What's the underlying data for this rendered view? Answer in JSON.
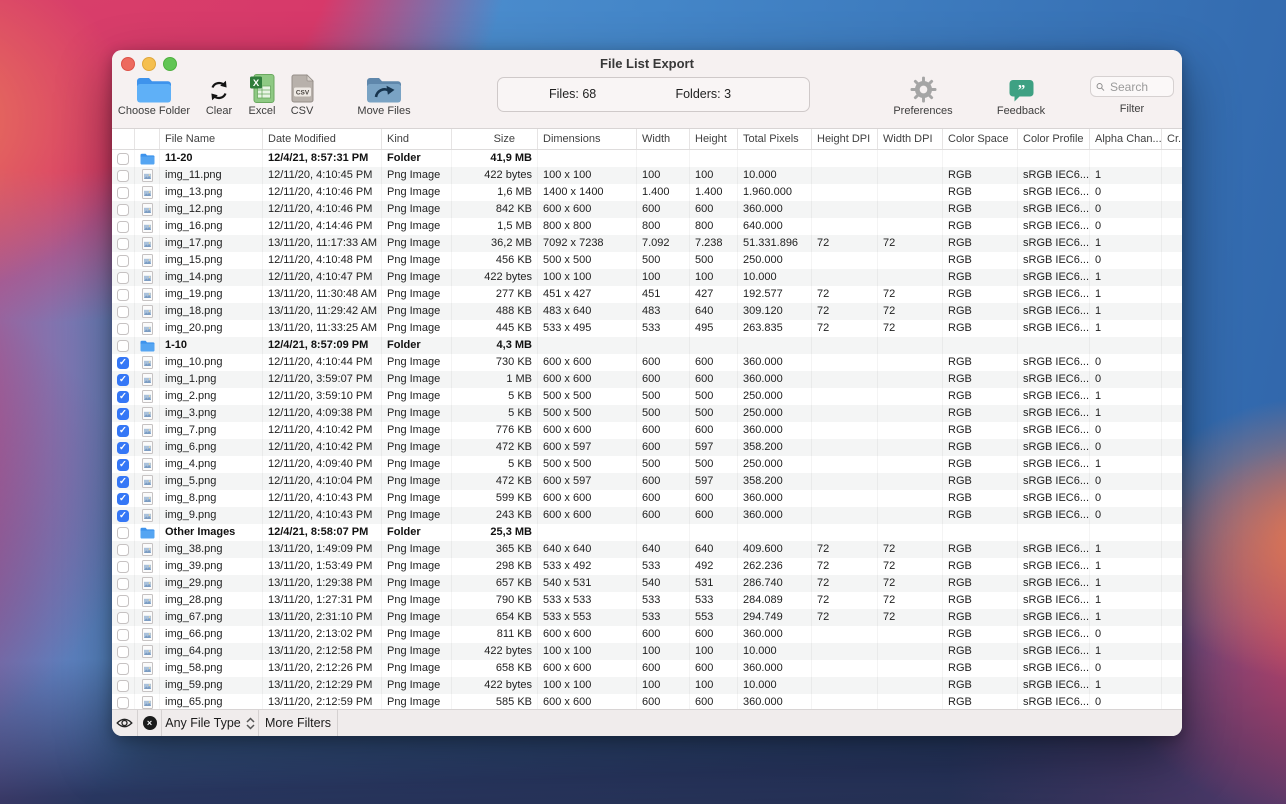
{
  "window": {
    "title": "File List Export"
  },
  "toolbar": {
    "choose_folder": "Choose Folder",
    "clear": "Clear",
    "excel": "Excel",
    "csv": "CSV",
    "move_files": "Move Files",
    "stats": {
      "files": "Files: 68",
      "folders": "Folders: 3"
    },
    "preferences": "Preferences",
    "feedback": "Feedback",
    "search_placeholder": "Search",
    "filter_label": "Filter"
  },
  "table": {
    "columns": [
      "File Name",
      "Date Modified",
      "Kind",
      "Size",
      "Dimensions",
      "Width",
      "Height",
      "Total Pixels",
      "Height DPI",
      "Width DPI",
      "Color Space",
      "Color Profile",
      "Alpha Chan...",
      "Cr..."
    ],
    "rows": [
      {
        "type": "folder",
        "checked": false,
        "name": "11-20",
        "date": "12/4/21, 8:57:31 PM",
        "kind": "Folder",
        "size": "41,9 MB",
        "dims": "",
        "w": "",
        "h": "",
        "px": "",
        "hdpi": "",
        "wdpi": "",
        "cs": "",
        "cp": "",
        "alpha": ""
      },
      {
        "type": "file",
        "checked": false,
        "name": "img_11.png",
        "date": "12/11/20, 4:10:45 PM",
        "kind": "Png Image",
        "size": "422 bytes",
        "dims": "100 x 100",
        "w": "100",
        "h": "100",
        "px": "10.000",
        "hdpi": "",
        "wdpi": "",
        "cs": "RGB",
        "cp": "sRGB IEC6...",
        "alpha": "1"
      },
      {
        "type": "file",
        "checked": false,
        "name": "img_13.png",
        "date": "12/11/20, 4:10:46 PM",
        "kind": "Png Image",
        "size": "1,6 MB",
        "dims": "1400 x 1400",
        "w": "1.400",
        "h": "1.400",
        "px": "1.960.000",
        "hdpi": "",
        "wdpi": "",
        "cs": "RGB",
        "cp": "sRGB IEC6...",
        "alpha": "0"
      },
      {
        "type": "file",
        "checked": false,
        "name": "img_12.png",
        "date": "12/11/20, 4:10:46 PM",
        "kind": "Png Image",
        "size": "842 KB",
        "dims": "600 x 600",
        "w": "600",
        "h": "600",
        "px": "360.000",
        "hdpi": "",
        "wdpi": "",
        "cs": "RGB",
        "cp": "sRGB IEC6...",
        "alpha": "0"
      },
      {
        "type": "file",
        "checked": false,
        "name": "img_16.png",
        "date": "12/11/20, 4:14:46 PM",
        "kind": "Png Image",
        "size": "1,5 MB",
        "dims": "800 x 800",
        "w": "800",
        "h": "800",
        "px": "640.000",
        "hdpi": "",
        "wdpi": "",
        "cs": "RGB",
        "cp": "sRGB IEC6...",
        "alpha": "0"
      },
      {
        "type": "file",
        "checked": false,
        "name": "img_17.png",
        "date": "13/11/20, 11:17:33 AM",
        "kind": "Png Image",
        "size": "36,2 MB",
        "dims": "7092 x 7238",
        "w": "7.092",
        "h": "7.238",
        "px": "51.331.896",
        "hdpi": "72",
        "wdpi": "72",
        "cs": "RGB",
        "cp": "sRGB IEC6...",
        "alpha": "1"
      },
      {
        "type": "file",
        "checked": false,
        "name": "img_15.png",
        "date": "12/11/20, 4:10:48 PM",
        "kind": "Png Image",
        "size": "456 KB",
        "dims": "500 x 500",
        "w": "500",
        "h": "500",
        "px": "250.000",
        "hdpi": "",
        "wdpi": "",
        "cs": "RGB",
        "cp": "sRGB IEC6...",
        "alpha": "0"
      },
      {
        "type": "file",
        "checked": false,
        "name": "img_14.png",
        "date": "12/11/20, 4:10:47 PM",
        "kind": "Png Image",
        "size": "422 bytes",
        "dims": "100 x 100",
        "w": "100",
        "h": "100",
        "px": "10.000",
        "hdpi": "",
        "wdpi": "",
        "cs": "RGB",
        "cp": "sRGB IEC6...",
        "alpha": "1"
      },
      {
        "type": "file",
        "checked": false,
        "name": "img_19.png",
        "date": "13/11/20, 11:30:48 AM",
        "kind": "Png Image",
        "size": "277 KB",
        "dims": "451 x 427",
        "w": "451",
        "h": "427",
        "px": "192.577",
        "hdpi": "72",
        "wdpi": "72",
        "cs": "RGB",
        "cp": "sRGB IEC6...",
        "alpha": "1"
      },
      {
        "type": "file",
        "checked": false,
        "name": "img_18.png",
        "date": "13/11/20, 11:29:42 AM",
        "kind": "Png Image",
        "size": "488 KB",
        "dims": "483 x 640",
        "w": "483",
        "h": "640",
        "px": "309.120",
        "hdpi": "72",
        "wdpi": "72",
        "cs": "RGB",
        "cp": "sRGB IEC6...",
        "alpha": "1"
      },
      {
        "type": "file",
        "checked": false,
        "name": "img_20.png",
        "date": "13/11/20, 11:33:25 AM",
        "kind": "Png Image",
        "size": "445 KB",
        "dims": "533 x 495",
        "w": "533",
        "h": "495",
        "px": "263.835",
        "hdpi": "72",
        "wdpi": "72",
        "cs": "RGB",
        "cp": "sRGB IEC6...",
        "alpha": "1"
      },
      {
        "type": "folder",
        "checked": false,
        "name": "1-10",
        "date": "12/4/21, 8:57:09 PM",
        "kind": "Folder",
        "size": "4,3 MB",
        "dims": "",
        "w": "",
        "h": "",
        "px": "",
        "hdpi": "",
        "wdpi": "",
        "cs": "",
        "cp": "",
        "alpha": ""
      },
      {
        "type": "file",
        "checked": true,
        "name": "img_10.png",
        "date": "12/11/20, 4:10:44 PM",
        "kind": "Png Image",
        "size": "730 KB",
        "dims": "600 x 600",
        "w": "600",
        "h": "600",
        "px": "360.000",
        "hdpi": "",
        "wdpi": "",
        "cs": "RGB",
        "cp": "sRGB IEC6...",
        "alpha": "0"
      },
      {
        "type": "file",
        "checked": true,
        "name": "img_1.png",
        "date": "12/11/20, 3:59:07 PM",
        "kind": "Png Image",
        "size": "1 MB",
        "dims": "600 x 600",
        "w": "600",
        "h": "600",
        "px": "360.000",
        "hdpi": "",
        "wdpi": "",
        "cs": "RGB",
        "cp": "sRGB IEC6...",
        "alpha": "0"
      },
      {
        "type": "file",
        "checked": true,
        "name": "img_2.png",
        "date": "12/11/20, 3:59:10 PM",
        "kind": "Png Image",
        "size": "5 KB",
        "dims": "500 x 500",
        "w": "500",
        "h": "500",
        "px": "250.000",
        "hdpi": "",
        "wdpi": "",
        "cs": "RGB",
        "cp": "sRGB IEC6...",
        "alpha": "1"
      },
      {
        "type": "file",
        "checked": true,
        "name": "img_3.png",
        "date": "12/11/20, 4:09:38 PM",
        "kind": "Png Image",
        "size": "5 KB",
        "dims": "500 x 500",
        "w": "500",
        "h": "500",
        "px": "250.000",
        "hdpi": "",
        "wdpi": "",
        "cs": "RGB",
        "cp": "sRGB IEC6...",
        "alpha": "1"
      },
      {
        "type": "file",
        "checked": true,
        "name": "img_7.png",
        "date": "12/11/20, 4:10:42 PM",
        "kind": "Png Image",
        "size": "776 KB",
        "dims": "600 x 600",
        "w": "600",
        "h": "600",
        "px": "360.000",
        "hdpi": "",
        "wdpi": "",
        "cs": "RGB",
        "cp": "sRGB IEC6...",
        "alpha": "0"
      },
      {
        "type": "file",
        "checked": true,
        "name": "img_6.png",
        "date": "12/11/20, 4:10:42 PM",
        "kind": "Png Image",
        "size": "472 KB",
        "dims": "600 x 597",
        "w": "600",
        "h": "597",
        "px": "358.200",
        "hdpi": "",
        "wdpi": "",
        "cs": "RGB",
        "cp": "sRGB IEC6...",
        "alpha": "0"
      },
      {
        "type": "file",
        "checked": true,
        "name": "img_4.png",
        "date": "12/11/20, 4:09:40 PM",
        "kind": "Png Image",
        "size": "5 KB",
        "dims": "500 x 500",
        "w": "500",
        "h": "500",
        "px": "250.000",
        "hdpi": "",
        "wdpi": "",
        "cs": "RGB",
        "cp": "sRGB IEC6...",
        "alpha": "1"
      },
      {
        "type": "file",
        "checked": true,
        "name": "img_5.png",
        "date": "12/11/20, 4:10:04 PM",
        "kind": "Png Image",
        "size": "472 KB",
        "dims": "600 x 597",
        "w": "600",
        "h": "597",
        "px": "358.200",
        "hdpi": "",
        "wdpi": "",
        "cs": "RGB",
        "cp": "sRGB IEC6...",
        "alpha": "0"
      },
      {
        "type": "file",
        "checked": true,
        "name": "img_8.png",
        "date": "12/11/20, 4:10:43 PM",
        "kind": "Png Image",
        "size": "599 KB",
        "dims": "600 x 600",
        "w": "600",
        "h": "600",
        "px": "360.000",
        "hdpi": "",
        "wdpi": "",
        "cs": "RGB",
        "cp": "sRGB IEC6...",
        "alpha": "0"
      },
      {
        "type": "file",
        "checked": true,
        "name": "img_9.png",
        "date": "12/11/20, 4:10:43 PM",
        "kind": "Png Image",
        "size": "243 KB",
        "dims": "600 x 600",
        "w": "600",
        "h": "600",
        "px": "360.000",
        "hdpi": "",
        "wdpi": "",
        "cs": "RGB",
        "cp": "sRGB IEC6...",
        "alpha": "0"
      },
      {
        "type": "folder",
        "checked": false,
        "name": "Other Images",
        "date": "12/4/21, 8:58:07 PM",
        "kind": "Folder",
        "size": "25,3 MB",
        "dims": "",
        "w": "",
        "h": "",
        "px": "",
        "hdpi": "",
        "wdpi": "",
        "cs": "",
        "cp": "",
        "alpha": ""
      },
      {
        "type": "file",
        "checked": false,
        "name": "img_38.png",
        "date": "13/11/20, 1:49:09 PM",
        "kind": "Png Image",
        "size": "365 KB",
        "dims": "640 x 640",
        "w": "640",
        "h": "640",
        "px": "409.600",
        "hdpi": "72",
        "wdpi": "72",
        "cs": "RGB",
        "cp": "sRGB IEC6...",
        "alpha": "1"
      },
      {
        "type": "file",
        "checked": false,
        "name": "img_39.png",
        "date": "13/11/20, 1:53:49 PM",
        "kind": "Png Image",
        "size": "298 KB",
        "dims": "533 x 492",
        "w": "533",
        "h": "492",
        "px": "262.236",
        "hdpi": "72",
        "wdpi": "72",
        "cs": "RGB",
        "cp": "sRGB IEC6...",
        "alpha": "1"
      },
      {
        "type": "file",
        "checked": false,
        "name": "img_29.png",
        "date": "13/11/20, 1:29:38 PM",
        "kind": "Png Image",
        "size": "657 KB",
        "dims": "540 x 531",
        "w": "540",
        "h": "531",
        "px": "286.740",
        "hdpi": "72",
        "wdpi": "72",
        "cs": "RGB",
        "cp": "sRGB IEC6...",
        "alpha": "1"
      },
      {
        "type": "file",
        "checked": false,
        "name": "img_28.png",
        "date": "13/11/20, 1:27:31 PM",
        "kind": "Png Image",
        "size": "790 KB",
        "dims": "533 x 533",
        "w": "533",
        "h": "533",
        "px": "284.089",
        "hdpi": "72",
        "wdpi": "72",
        "cs": "RGB",
        "cp": "sRGB IEC6...",
        "alpha": "1"
      },
      {
        "type": "file",
        "checked": false,
        "name": "img_67.png",
        "date": "13/11/20, 2:31:10 PM",
        "kind": "Png Image",
        "size": "654 KB",
        "dims": "533 x 553",
        "w": "533",
        "h": "553",
        "px": "294.749",
        "hdpi": "72",
        "wdpi": "72",
        "cs": "RGB",
        "cp": "sRGB IEC6...",
        "alpha": "1"
      },
      {
        "type": "file",
        "checked": false,
        "name": "img_66.png",
        "date": "13/11/20, 2:13:02 PM",
        "kind": "Png Image",
        "size": "811 KB",
        "dims": "600 x 600",
        "w": "600",
        "h": "600",
        "px": "360.000",
        "hdpi": "",
        "wdpi": "",
        "cs": "RGB",
        "cp": "sRGB IEC6...",
        "alpha": "0"
      },
      {
        "type": "file",
        "checked": false,
        "name": "img_64.png",
        "date": "13/11/20, 2:12:58 PM",
        "kind": "Png Image",
        "size": "422 bytes",
        "dims": "100 x 100",
        "w": "100",
        "h": "100",
        "px": "10.000",
        "hdpi": "",
        "wdpi": "",
        "cs": "RGB",
        "cp": "sRGB IEC6...",
        "alpha": "1"
      },
      {
        "type": "file",
        "checked": false,
        "name": "img_58.png",
        "date": "13/11/20, 2:12:26 PM",
        "kind": "Png Image",
        "size": "658 KB",
        "dims": "600 x 600",
        "w": "600",
        "h": "600",
        "px": "360.000",
        "hdpi": "",
        "wdpi": "",
        "cs": "RGB",
        "cp": "sRGB IEC6...",
        "alpha": "0"
      },
      {
        "type": "file",
        "checked": false,
        "name": "img_59.png",
        "date": "13/11/20, 2:12:29 PM",
        "kind": "Png Image",
        "size": "422 bytes",
        "dims": "100 x 100",
        "w": "100",
        "h": "100",
        "px": "10.000",
        "hdpi": "",
        "wdpi": "",
        "cs": "RGB",
        "cp": "sRGB IEC6...",
        "alpha": "1"
      },
      {
        "type": "file",
        "checked": false,
        "name": "img_65.png",
        "date": "13/11/20, 2:12:59 PM",
        "kind": "Png Image",
        "size": "585 KB",
        "dims": "600 x 600",
        "w": "600",
        "h": "600",
        "px": "360.000",
        "hdpi": "",
        "wdpi": "",
        "cs": "RGB",
        "cp": "sRGB IEC6...",
        "alpha": "0"
      }
    ]
  },
  "filter_bar": {
    "file_type": "Any File Type",
    "more_filters": "More Filters"
  },
  "colors": {
    "checkbox_blue": "#3577f6",
    "folder_blue": "#55a5f2",
    "folder_tab_blue": "#3e93ec",
    "excel_green": "#8ec983",
    "excel_badge_green": "#2f7d3b",
    "csv_gray": "#b8b1ab",
    "feedback_green": "#3ea183",
    "move_folder_blue": "#7aa3c4"
  }
}
